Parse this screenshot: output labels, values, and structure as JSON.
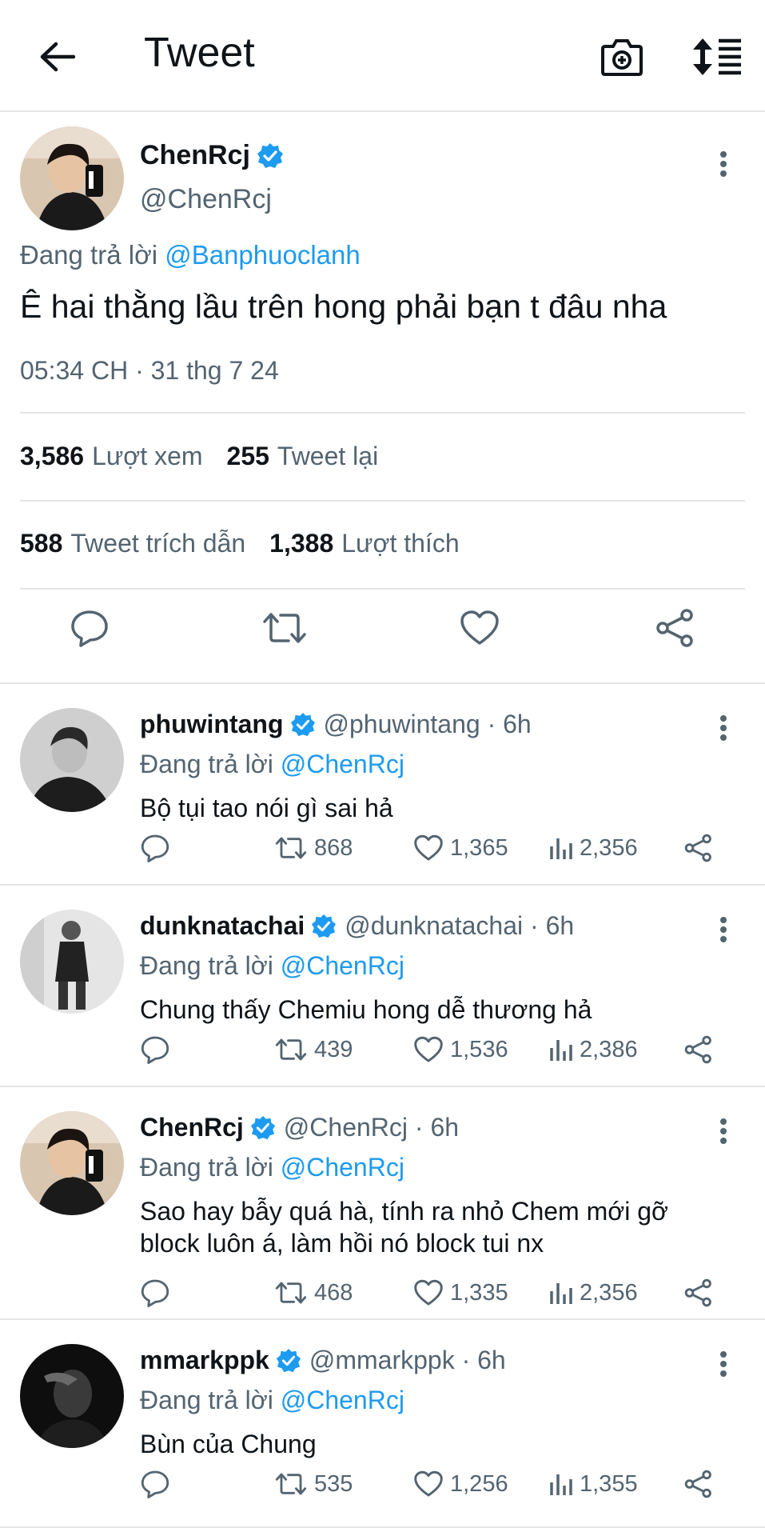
{
  "header": {
    "title": "Tweet"
  },
  "tweet": {
    "name": "ChenRcj",
    "handle": "@ChenRcj",
    "reply_prefix": "Đang trả lời",
    "reply_to": "@Banphuoclanh",
    "text": "Ê hai thằng lầu trên hong phải bạn t đâu nha",
    "time": "05:34 CH · 31 thg 7 24",
    "views_count": "3,586",
    "views_label": "Lượt xem",
    "retweets_count": "255",
    "retweets_label": "Tweet lại",
    "quotes_count": "588",
    "quotes_label": "Tweet trích dẫn",
    "likes_count": "1,388",
    "likes_label": "Lượt thích"
  },
  "replies": [
    {
      "name": "phuwintang",
      "handle": "@phuwintang · 6h",
      "reply_prefix": "Đang trả lời",
      "reply_to": "@ChenRcj",
      "text": "Bộ tụi tao nói gì sai hả",
      "retweets": "868",
      "likes": "1,365",
      "views": "2,356"
    },
    {
      "name": "dunknatachai",
      "handle": "@dunknatachai · 6h",
      "reply_prefix": "Đang trả lời",
      "reply_to": "@ChenRcj",
      "text": "Chung thấy Chemiu hong dễ thương hả",
      "retweets": "439",
      "likes": "1,536",
      "views": "2,386"
    },
    {
      "name": "ChenRcj",
      "handle": "@ChenRcj · 6h",
      "reply_prefix": "Đang trả lời",
      "reply_to": "@ChenRcj",
      "text": "Sao hay bẫy quá hà, tính ra nhỏ Chem mới gỡ block luôn á, làm hồi nó block tui nx",
      "retweets": "468",
      "likes": "1,335",
      "views": "2,356"
    },
    {
      "name": "mmarkppk",
      "handle": "@mmarkppk · 6h",
      "reply_prefix": "Đang trả lời",
      "reply_to": "@ChenRcj",
      "text": "Bùn của Chung",
      "retweets": "535",
      "likes": "1,256",
      "views": "1,355"
    }
  ],
  "colors": {
    "accent": "#1d9bf0",
    "text": "#0f1419",
    "muted": "#536471",
    "divider": "#e6e6e6"
  }
}
